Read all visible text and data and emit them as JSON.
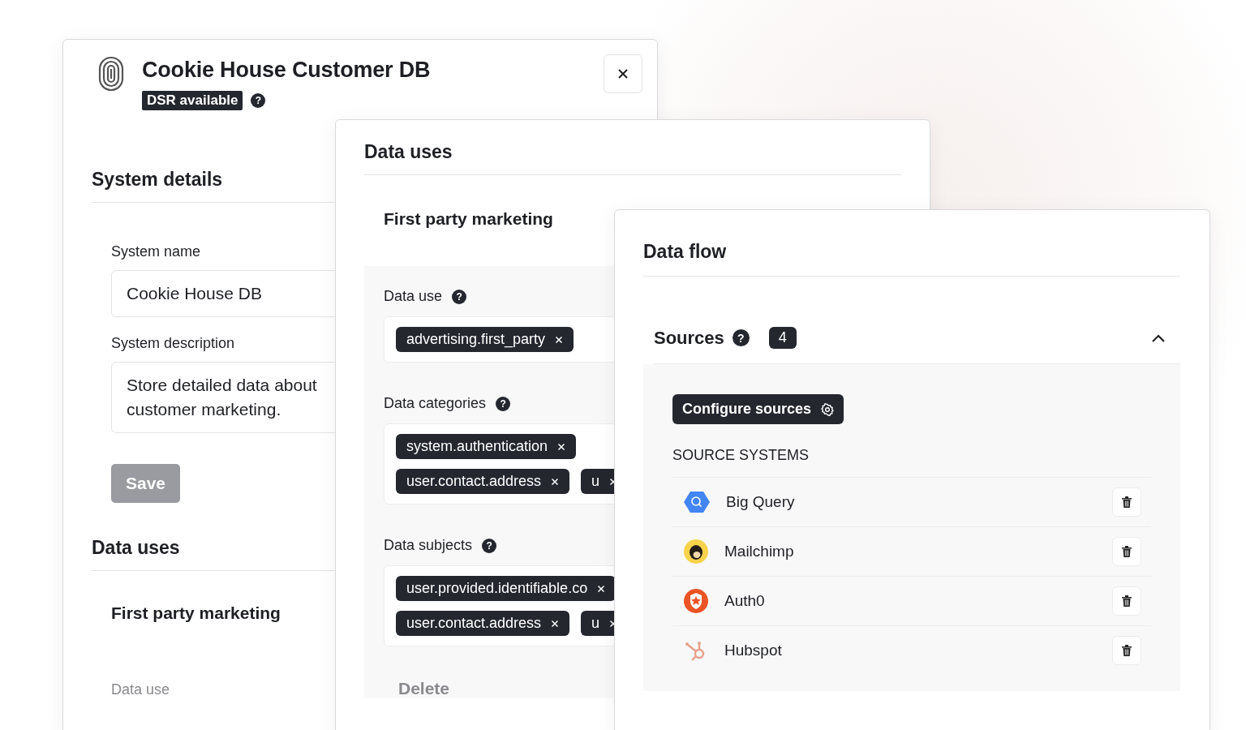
{
  "system_panel": {
    "title": "Cookie House Customer DB",
    "badge": "DSR available",
    "badge_help": "?",
    "section_title": "System details",
    "fields": [
      {
        "label": "System name",
        "value": "Cookie House DB"
      },
      {
        "label": "System description",
        "value": "Store detailed data about\ncustomer marketing."
      }
    ],
    "save_button": {
      "label": "Save",
      "disabled": true
    },
    "uses_title": "Data uses",
    "use_name": "First party marketing",
    "use_label": "Data use"
  },
  "uses_panel": {
    "title": "Data uses",
    "use_name": "First party marketing",
    "groups": [
      {
        "label": "Data use",
        "help": "?",
        "chips": [
          [
            "advertising.first_party"
          ]
        ]
      },
      {
        "label": "Data categories",
        "help": "?",
        "chips": [
          [
            "system.authentication"
          ],
          [
            "user.contact.address",
            "u"
          ]
        ]
      },
      {
        "label": "Data subjects",
        "help": "?",
        "chips": [
          [
            "user.provided.identifiable.co"
          ],
          [
            "user.contact.address",
            "u"
          ]
        ]
      }
    ],
    "delete_button": "Delete"
  },
  "flow_panel": {
    "title": "Data flow",
    "section": "Sources",
    "section_help": "?",
    "count": "4",
    "expanded": true,
    "configure_button": "Configure sources",
    "list_title": "SOURCE SYSTEMS",
    "sources": [
      {
        "name": "Big Query",
        "kind": "bigquery"
      },
      {
        "name": "Mailchimp",
        "kind": "mailchimp"
      },
      {
        "name": "Auth0",
        "kind": "auth0"
      },
      {
        "name": "Hubspot",
        "kind": "hubspot"
      }
    ]
  }
}
